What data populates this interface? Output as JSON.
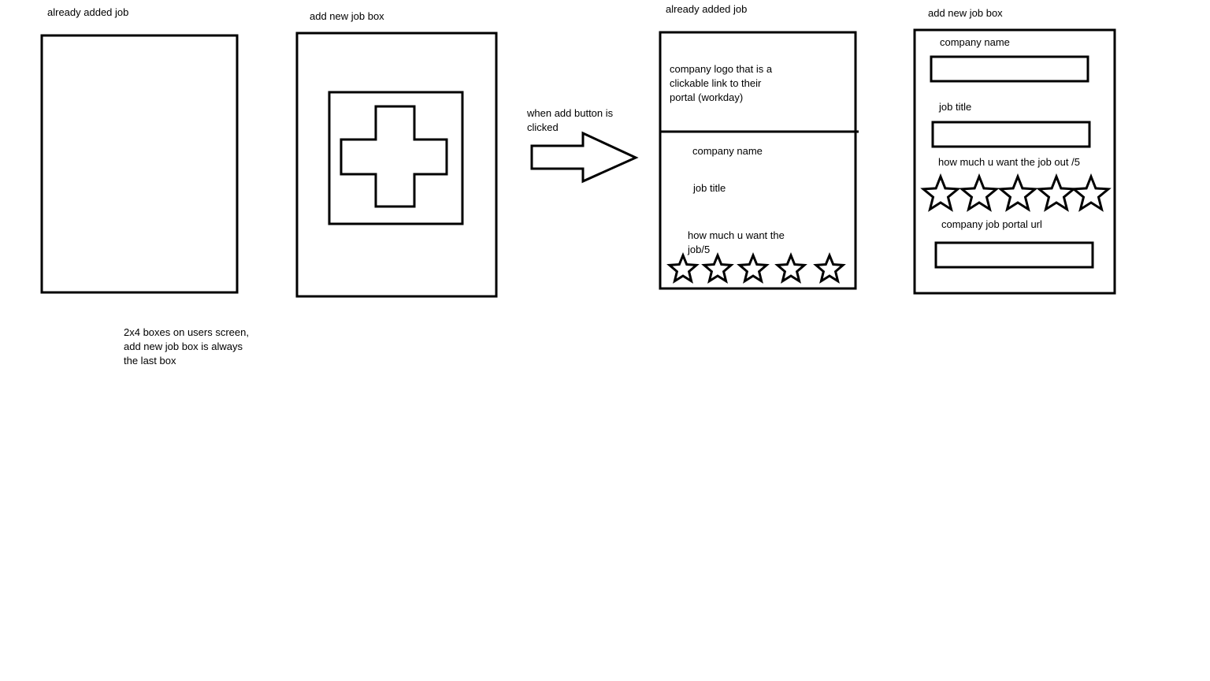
{
  "panel1": {
    "title": "already added job"
  },
  "panel2": {
    "title": "add new job box"
  },
  "arrow": {
    "caption": "when add button is clicked"
  },
  "panel3": {
    "title": "already added job",
    "logo_text": "company logo that is a clickable link to their portal (workday)",
    "company_label": "company name",
    "job_title_label": "job title",
    "rating_label": "how much u want the job/5",
    "star_count": 5
  },
  "panel4": {
    "title": "add new job box",
    "company_label": "company name",
    "job_title_label": "job title",
    "rating_label": "how much u want the job out /5",
    "url_label": "company job portal url",
    "star_count": 5
  },
  "note": {
    "text": "2x4 boxes on users screen, add new job box is always the last box"
  }
}
